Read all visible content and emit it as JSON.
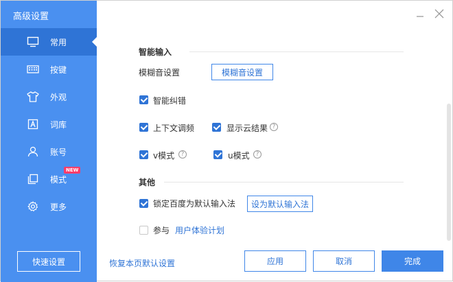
{
  "window": {
    "title": "高级设置"
  },
  "sidebar": {
    "items": [
      {
        "label": "常用",
        "icon": "monitor-icon"
      },
      {
        "label": "按键",
        "icon": "keyboard-icon"
      },
      {
        "label": "外观",
        "icon": "shirt-icon"
      },
      {
        "label": "词库",
        "icon": "dictionary-icon"
      },
      {
        "label": "账号",
        "icon": "user-icon"
      },
      {
        "label": "模式",
        "icon": "mode-icon",
        "badge": "NEW"
      },
      {
        "label": "更多",
        "icon": "gear-icon"
      }
    ],
    "quick_settings": "快速设置"
  },
  "main": {
    "smart_input": {
      "header": "智能输入",
      "fuzzy_label": "模糊音设置",
      "fuzzy_button": "模糊音设置",
      "smart_correction": "智能纠错",
      "context_tuning": "上下文调频",
      "show_cloud": "显示云结果",
      "v_mode": "v模式",
      "u_mode": "u模式"
    },
    "other": {
      "header": "其他",
      "lock_default": "锁定百度为默认输入法",
      "set_default_button": "设为默认输入法",
      "participate": "参与",
      "experience_plan": "用户体验计划"
    }
  },
  "footer": {
    "restore_default": "恢复本页默认设置",
    "apply": "应用",
    "cancel": "取消",
    "done": "完成"
  },
  "help_glyph": "?",
  "colors": {
    "sidebar": "#4a90f0",
    "active": "#2f74d6",
    "accent": "#3f86e8",
    "badge": "#ff3d6b"
  }
}
